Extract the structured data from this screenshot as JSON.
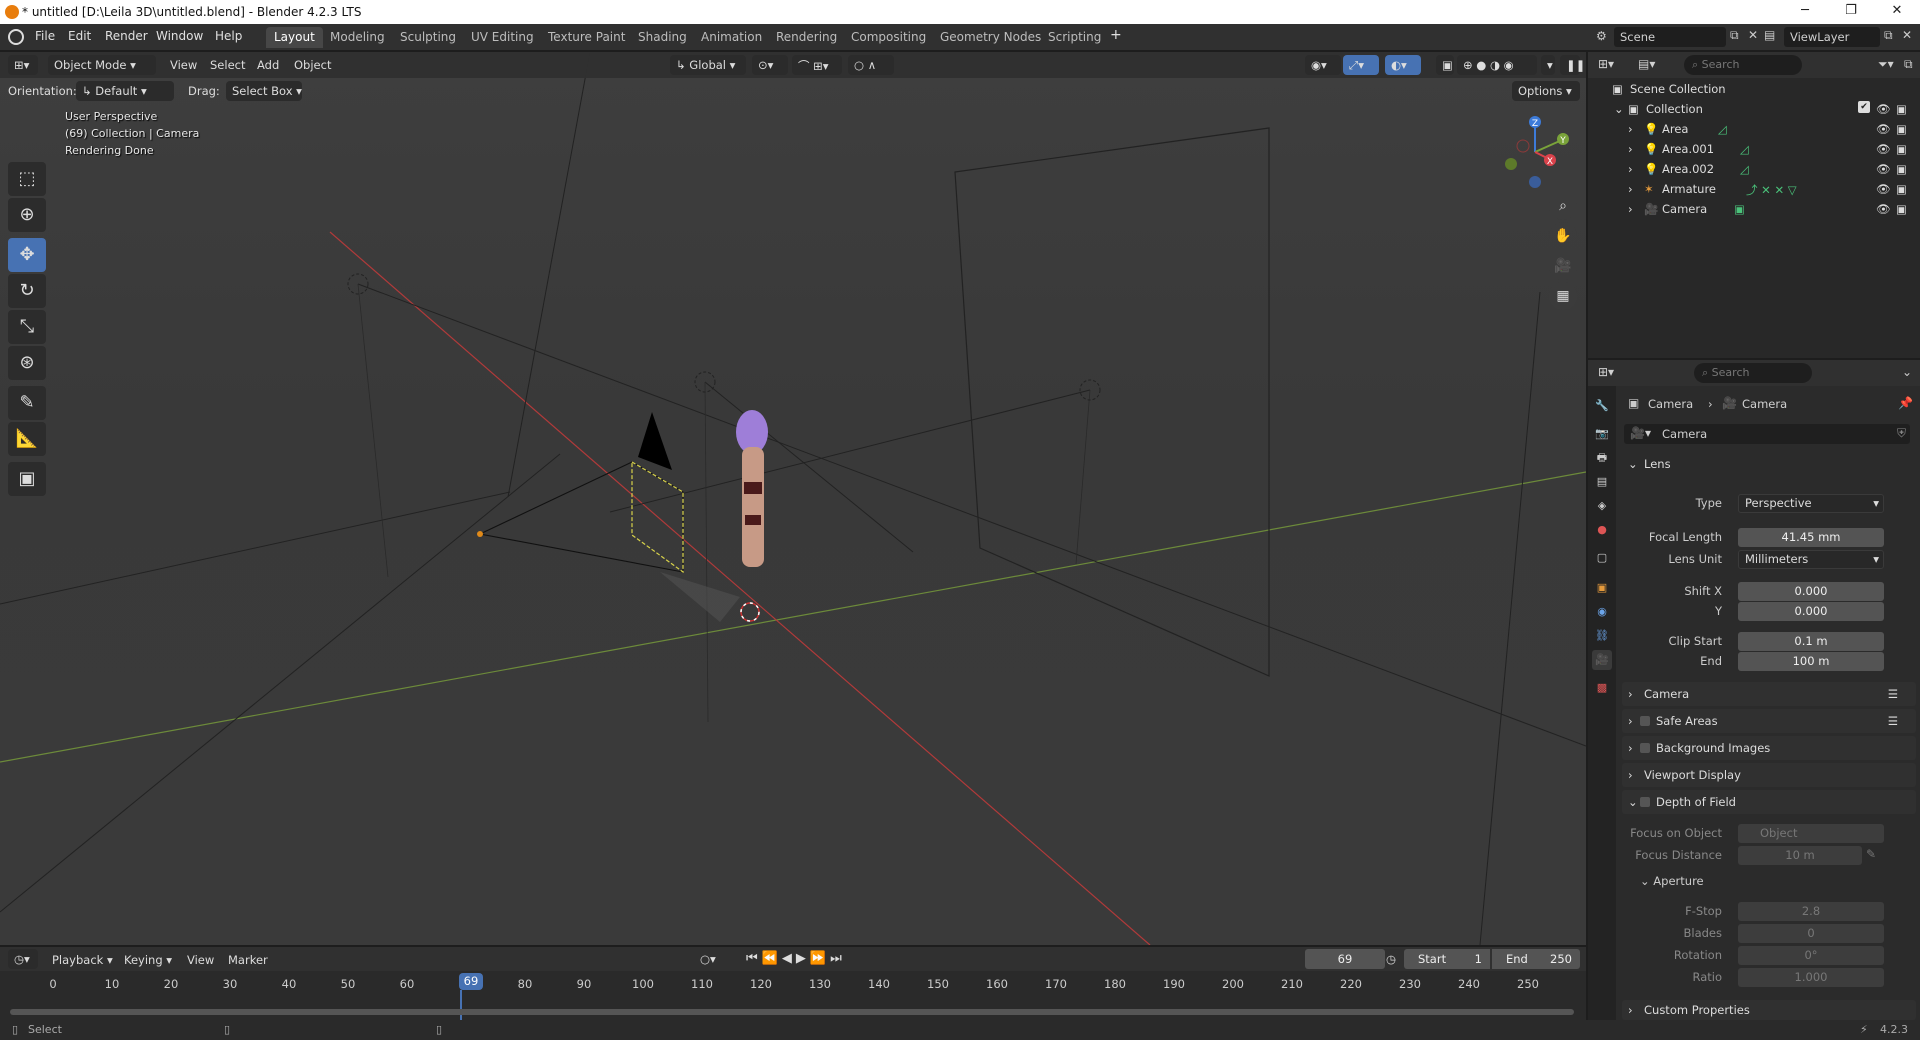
{
  "window": {
    "title": "* untitled [D:\\Leila 3D\\untitled.blend] - Blender 4.2.3 LTS"
  },
  "menu": [
    "File",
    "Edit",
    "Render",
    "Window",
    "Help"
  ],
  "workspaces": [
    "Layout",
    "Modeling",
    "Sculpting",
    "UV Editing",
    "Texture Paint",
    "Shading",
    "Animation",
    "Rendering",
    "Compositing",
    "Geometry Nodes",
    "Scripting"
  ],
  "top_right": {
    "scene": "Scene",
    "view_layer": "ViewLayer"
  },
  "viewport": {
    "mode": "Object Mode",
    "menus": [
      "View",
      "Select",
      "Add",
      "Object"
    ],
    "transform_orientation": "Global",
    "orientation_label": "Orientation:",
    "orientation_value": "Default",
    "drag_label": "Drag:",
    "drag_value": "Select Box",
    "options": "Options",
    "overlay_lines": [
      "User Perspective",
      "(69) Collection | Camera",
      "Rendering Done"
    ],
    "gizmo": {
      "z": "Z",
      "y": "Y",
      "x": "X"
    }
  },
  "timeline": {
    "menus": [
      "Playback",
      "Keying",
      "View",
      "Marker"
    ],
    "current_frame": "69",
    "start_label": "Start",
    "start": "1",
    "end_label": "End",
    "end": "250",
    "ticks": [
      "0",
      "10",
      "20",
      "30",
      "40",
      "50",
      "60",
      "69",
      "80",
      "90",
      "100",
      "110",
      "120",
      "130",
      "140",
      "150",
      "160",
      "170",
      "180",
      "190",
      "200",
      "210",
      "220",
      "230",
      "240",
      "250"
    ],
    "current_marker": "69"
  },
  "status": {
    "left": "Select",
    "version": "4.2.3"
  },
  "outliner": {
    "search_placeholder": "Search",
    "scene_collection": "Scene Collection",
    "collection": "Collection",
    "items": [
      "Area",
      "Area.001",
      "Area.002",
      "Armature",
      "Camera"
    ]
  },
  "properties": {
    "search_placeholder": "Search",
    "breadcrumb": [
      "Camera",
      "Camera"
    ],
    "datablock": "Camera",
    "lens": {
      "title": "Lens",
      "type_label": "Type",
      "type_value": "Perspective",
      "focal_label": "Focal Length",
      "focal_value": "41.45 mm",
      "unit_label": "Lens Unit",
      "unit_value": "Millimeters",
      "shiftx_label": "Shift X",
      "shiftx_value": "0.000",
      "y_label": "Y",
      "y_value": "0.000",
      "clipstart_label": "Clip Start",
      "clipstart_value": "0.1 m",
      "end_label": "End",
      "end_value": "100 m"
    },
    "panels": [
      "Camera",
      "Safe Areas",
      "Background Images",
      "Viewport Display",
      "Depth of Field"
    ],
    "dof": {
      "focus_obj_label": "Focus on Object",
      "focus_obj_placeholder": "Object",
      "focus_dist_label": "Focus Distance",
      "focus_dist_value": "10 m",
      "aperture": "Aperture",
      "fstop_label": "F-Stop",
      "fstop_value": "2.8",
      "blades_label": "Blades",
      "blades_value": "0",
      "rotation_label": "Rotation",
      "rotation_value": "0°",
      "ratio_label": "Ratio",
      "ratio_value": "1.000"
    },
    "custom_properties": "Custom Properties"
  }
}
